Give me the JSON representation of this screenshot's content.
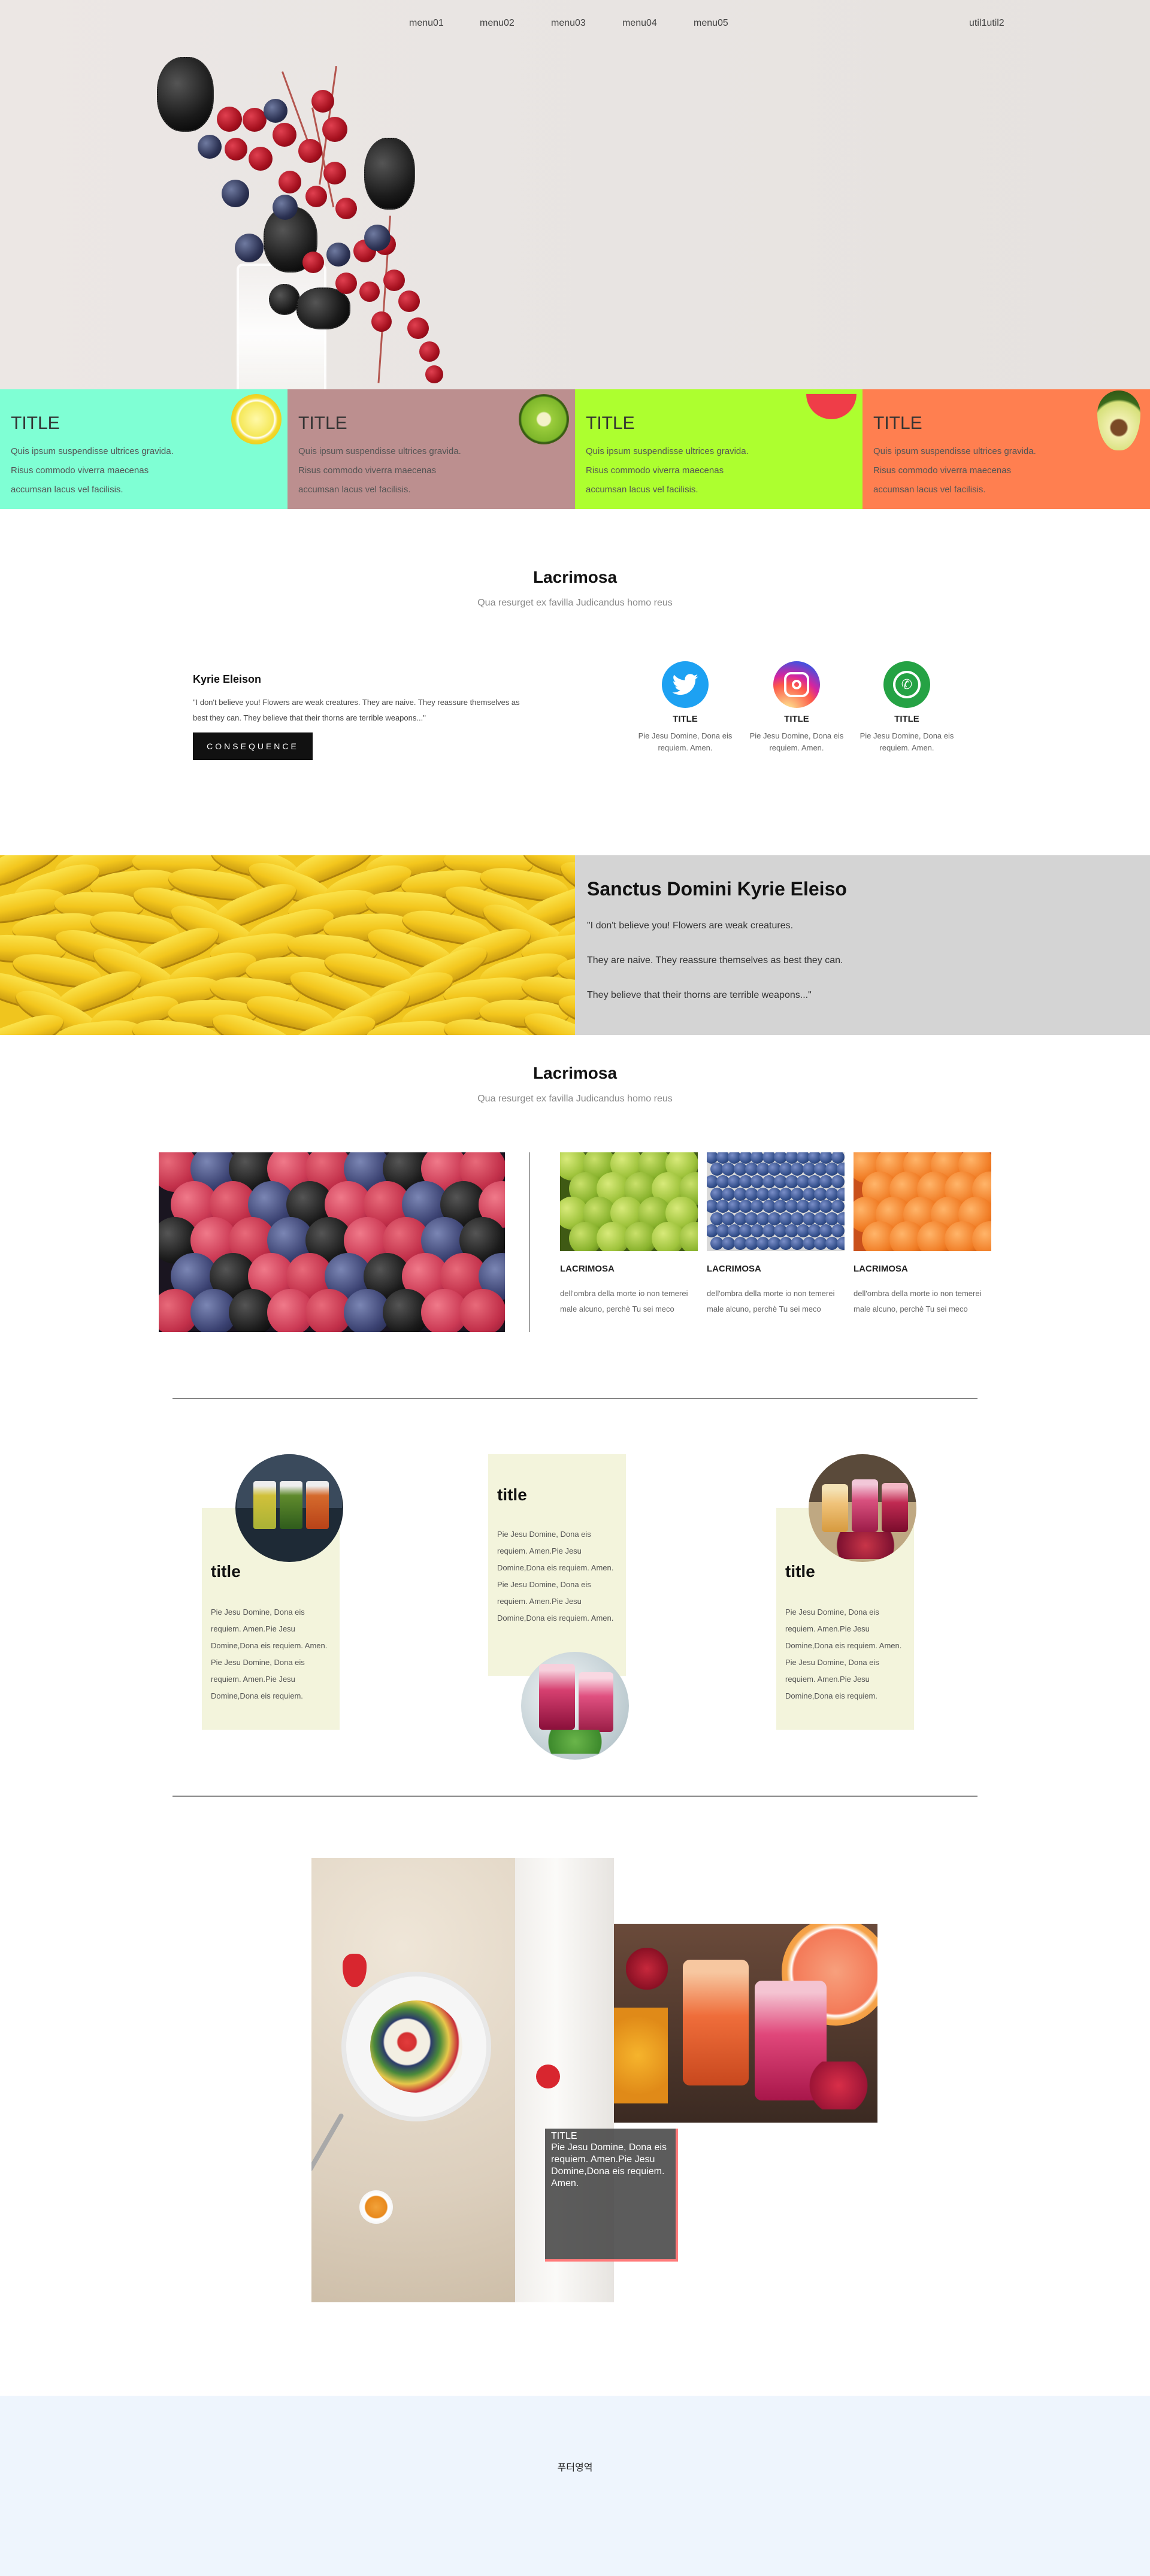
{
  "nav": {
    "menus": [
      "menu01",
      "menu02",
      "menu03",
      "menu04",
      "menu05"
    ],
    "util": "util1util2"
  },
  "features": [
    {
      "title": "TITLE",
      "text": "Quis ipsum suspendisse ultrices gravida. Risus commodo viverra maecenas accumsan lacus vel facilisis.",
      "color": "#7fffd4",
      "icon": "lemon-icon"
    },
    {
      "title": "TITLE",
      "text": "Quis ipsum suspendisse ultrices gravida. Risus commodo viverra maecenas accumsan lacus vel facilisis.",
      "color": "#bc8f8f",
      "icon": "kiwi-icon"
    },
    {
      "title": "TITLE",
      "text": "Quis ipsum suspendisse ultrices gravida. Risus commodo viverra maecenas accumsan lacus vel facilisis.",
      "color": "#adff2f",
      "icon": "watermelon-icon"
    },
    {
      "title": "TITLE",
      "text": "Quis ipsum suspendisse ultrices gravida. Risus commodo viverra maecenas accumsan lacus vel facilisis.",
      "color": "#ff7f50",
      "icon": "avocado-icon"
    }
  ],
  "intro": {
    "title": "Lacrimosa",
    "subtitle": "Qua resurget ex favilla Judicandus homo reus"
  },
  "kyrie": {
    "title": "Kyrie Eleison",
    "text": "\"I don't believe you! Flowers are weak creatures. They are naive. They reassure themselves as best they can. They believe that their thorns are terrible weapons...\"",
    "button": "CONSEQUENCE"
  },
  "social": [
    {
      "icon": "twitter-icon",
      "title": "TITLE",
      "text": "Pie Jesu Domine, Dona eis requiem. Amen.",
      "color": "#1da1f2"
    },
    {
      "icon": "instagram-icon",
      "title": "TITLE",
      "text": "Pie Jesu Domine, Dona eis requiem. Amen.",
      "color": "#c13584"
    },
    {
      "icon": "whatsapp-icon",
      "title": "TITLE",
      "text": "Pie Jesu Domine, Dona eis requiem. Amen.",
      "color": "#25d366"
    }
  ],
  "sanctus": {
    "title": "Sanctus Domini Kyrie Eleiso",
    "lines": [
      "\"I don't believe you! Flowers are weak creatures.",
      "They are naive. They reassure themselves as best they can.",
      "They believe that their thorns are terrible weapons...\""
    ]
  },
  "gallery_section": {
    "title": "Lacrimosa",
    "subtitle": "Qua resurget ex favilla Judicandus homo reus",
    "items": [
      {
        "title": "LACRIMOSA",
        "text": "dell'ombra della morte io non temerei male alcuno, perchè Tu sei meco"
      },
      {
        "title": "LACRIMOSA",
        "text": "dell'ombra della morte io non temerei male alcuno, perchè Tu sei meco"
      },
      {
        "title": "LACRIMOSA",
        "text": "dell'ombra della morte io non temerei male alcuno, perchè Tu sei meco"
      }
    ]
  },
  "cards": [
    {
      "title": "title",
      "text": "Pie Jesu Domine, Dona eis requiem. Amen.Pie Jesu Domine,Dona eis requiem. Amen.\nPie Jesu Domine, Dona eis requiem. Amen.Pie Jesu Domine,Dona eis requiem."
    },
    {
      "title": "title",
      "text": "Pie Jesu Domine, Dona eis requiem. Amen.Pie Jesu Domine,Dona eis requiem. Amen.\nPie Jesu Domine, Dona eis requiem. Amen.Pie Jesu Domine,Dona eis requiem. Amen."
    },
    {
      "title": "title",
      "text": "Pie Jesu Domine, Dona eis requiem. Amen.Pie Jesu Domine,Dona eis requiem. Amen.\nPie Jesu Domine, Dona eis requiem. Amen.Pie Jesu Domine,Dona eis requiem."
    }
  ],
  "overlay": {
    "title": "TITLE",
    "text": "Pie Jesu Domine, Dona eis requiem. Amen.Pie Jesu Domine,Dona eis requiem. Amen."
  },
  "footer": {
    "text": "푸터영역"
  }
}
